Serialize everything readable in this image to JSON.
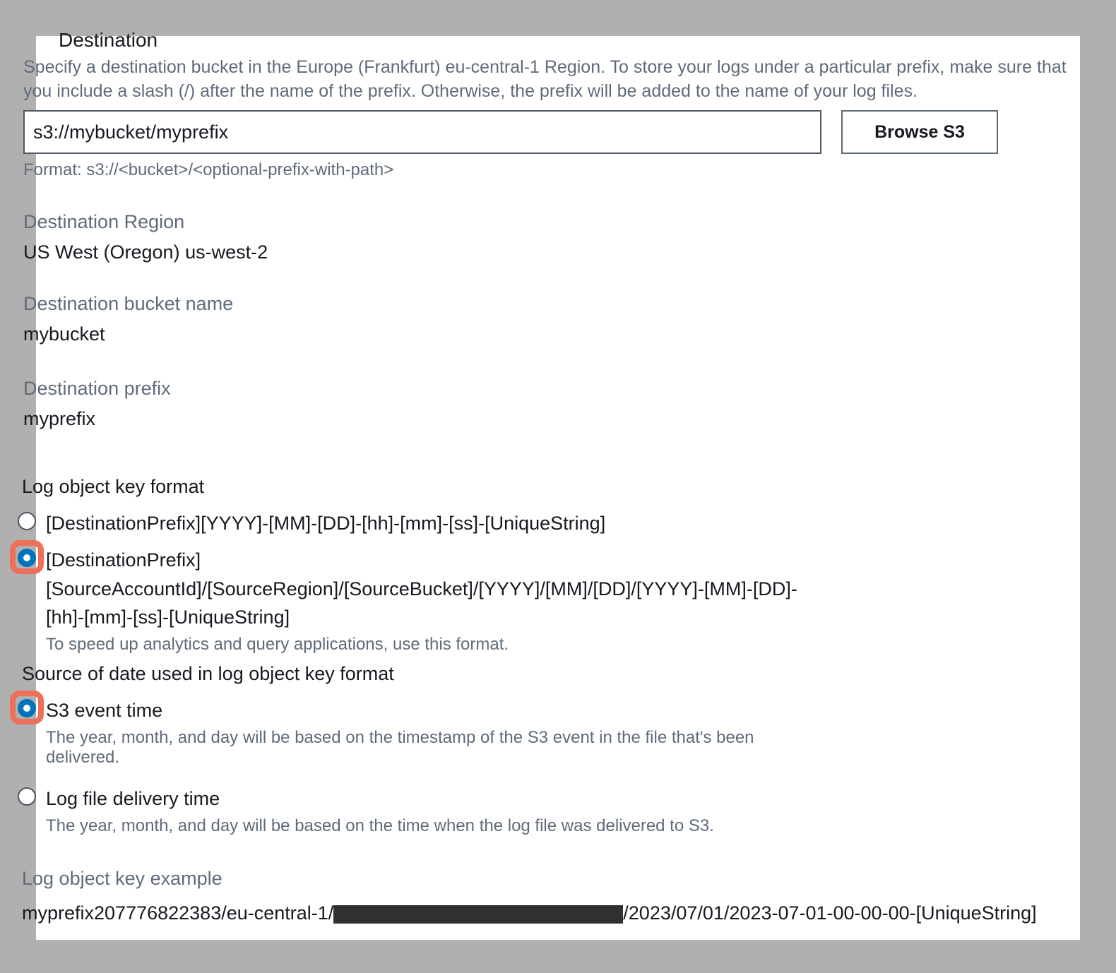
{
  "destination": {
    "heading": "Destination",
    "description": "Specify a destination bucket in the Europe (Frankfurt) eu-central-1 Region. To store your logs under a particular prefix, make sure that you include a slash (/) after the name of the prefix. Otherwise, the prefix will be added to the name of your log files.",
    "input_value": "s3://mybucket/myprefix",
    "browse_label": "Browse S3",
    "format_hint": "Format: s3://<bucket>/<optional-prefix-with-path>"
  },
  "fields": {
    "region_label": "Destination Region",
    "region_value": "US West (Oregon) us-west-2",
    "bucket_label": "Destination bucket name",
    "bucket_value": "mybucket",
    "prefix_label": "Destination prefix",
    "prefix_value": "myprefix"
  },
  "key_format": {
    "title": "Log object key format",
    "option1_label": "[DestinationPrefix][YYYY]-[MM]-[DD]-[hh]-[mm]-[ss]-[UniqueString]",
    "option2_label": "[DestinationPrefix][SourceAccountId]/[SourceRegion]/[SourceBucket]/[YYYY]/[MM]/[DD]/[YYYY]-[MM]-[DD]-[hh]-[mm]-[ss]-[UniqueString]",
    "option2_help": "To speed up analytics and query applications, use this format.",
    "selected": "option2"
  },
  "date_source": {
    "title": "Source of date used in log object key format",
    "option1_label": "S3 event time",
    "option1_help": "The year, month, and day will be based on the timestamp of the S3 event in the file that's been delivered.",
    "option2_label": "Log file delivery time",
    "option2_help": "The year, month, and day will be based on the time when the log file was delivered to S3.",
    "selected": "option1"
  },
  "example": {
    "title": "Log object key example",
    "prefix_part": "myprefix207776822383/eu-central-1/",
    "suffix_part": "/2023/07/01/2023-07-01-00-00-00-[UniqueString]"
  }
}
